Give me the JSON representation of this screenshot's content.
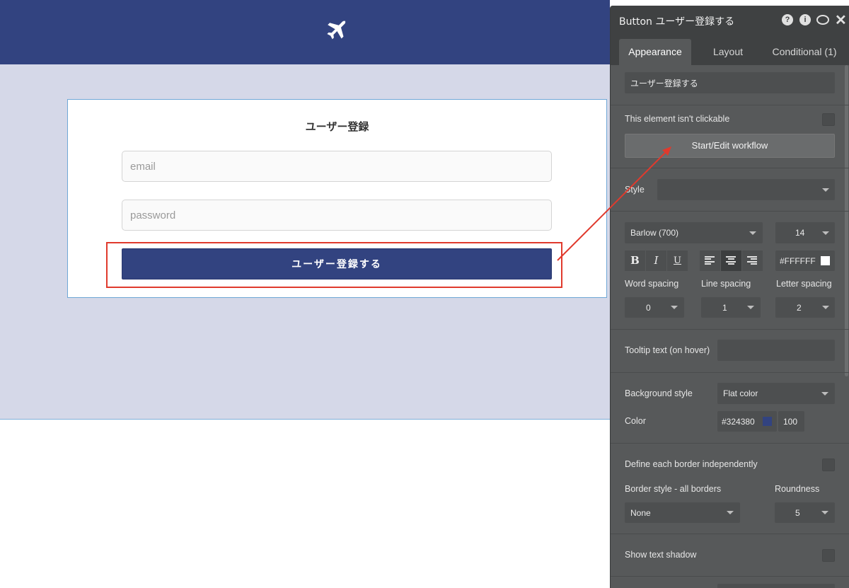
{
  "canvas": {
    "header_icon": "airplane-icon",
    "signup_form": {
      "title": "ユーザー登録",
      "email_placeholder": "email",
      "password_placeholder": "password",
      "submit_label": "ユーザー登録する"
    }
  },
  "panel": {
    "title": "Button ユーザー登録する",
    "icons": [
      "help-icon",
      "info-icon",
      "comment-icon",
      "close-icon"
    ],
    "tabs": [
      {
        "label": "Appearance",
        "active": true
      },
      {
        "label": "Layout",
        "active": false
      },
      {
        "label": "Conditional (1)",
        "active": false
      }
    ],
    "button_text": "ユーザー登録する",
    "not_clickable_label": "This element isn't clickable",
    "workflow_button": "Start/Edit workflow",
    "style_label": "Style",
    "style_value": "",
    "font": {
      "family": "Barlow (700)",
      "size": "14",
      "bold_label": "B",
      "italic_label": "I",
      "underline_label": "U",
      "alignment": "center",
      "color_hex": "#FFFFFF",
      "word_spacing_label": "Word spacing",
      "word_spacing": "0",
      "line_spacing_label": "Line spacing",
      "line_spacing": "1",
      "letter_spacing_label": "Letter spacing",
      "letter_spacing": "2"
    },
    "tooltip_label": "Tooltip text (on hover)",
    "tooltip_value": "",
    "background": {
      "style_label": "Background style",
      "style_value": "Flat color",
      "color_label": "Color",
      "color_hex": "#324380",
      "opacity": "100"
    },
    "border": {
      "independent_label": "Define each border independently",
      "style_label": "Border style - all borders",
      "style_value": "None",
      "roundness_label": "Roundness",
      "roundness_value": "5"
    },
    "shadow_label": "Show text shadow"
  },
  "colors": {
    "brand_navy": "#324380",
    "annotation_red": "#e03a2d",
    "panel_bg": "#57595a"
  }
}
